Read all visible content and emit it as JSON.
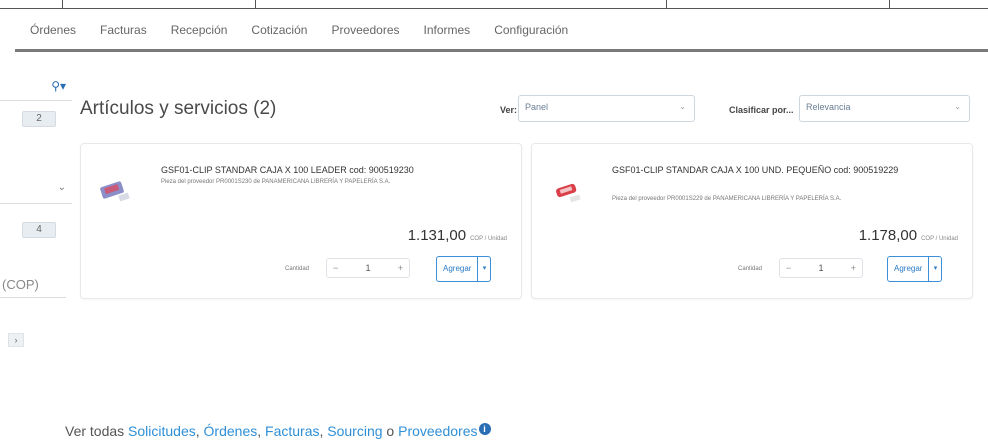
{
  "nav": {
    "items": [
      "Órdenes",
      "Facturas",
      "Recepción",
      "Cotización",
      "Proveedores",
      "Informes",
      "Configuración"
    ]
  },
  "sidebar": {
    "badge_top": "2",
    "badge_mid": "4",
    "currency": "(COP)",
    "small_btn": "›"
  },
  "header": {
    "title": "Artículos y servicios (2)",
    "view_label": "Ver:",
    "view_value": "Panel",
    "sort_label": "Clasificar por...",
    "sort_value": "Relevancia"
  },
  "products": [
    {
      "name": "GSF01-CLIP STANDAR CAJA X 100 LEADER cod: 900519230",
      "supplier_line": "Pieza del proveedor PR0001S230 de PANAMERICANA LIBRERÍA Y PAPELERÍA S.A.",
      "price": "1.131,00",
      "unit": "COP / Unidad",
      "qty_label": "Cantidad",
      "qty": "1",
      "add_label": "Agregar"
    },
    {
      "name": "GSF01-CLIP STANDAR CAJA X 100 UND. PEQUEÑO cod: 900519229",
      "supplier_line": "Pieza del proveedor PR0001S229 de PANAMERICANA LIBRERÍA Y PAPELERÍA S.A.",
      "price": "1.178,00",
      "unit": "COP / Unidad",
      "qty_label": "Cantidad",
      "qty": "1",
      "add_label": "Agregar"
    }
  ],
  "footer": {
    "prefix": "Ver todas",
    "link1": "Solicitudes",
    "link2": "Órdenes",
    "link3": "Facturas",
    "link4": "Sourcing",
    "conj": "o",
    "link5": "Proveedores",
    "info": "i"
  },
  "colors": {
    "accent": "#2f8fd6",
    "nav_rule": "#7a7a7a"
  }
}
